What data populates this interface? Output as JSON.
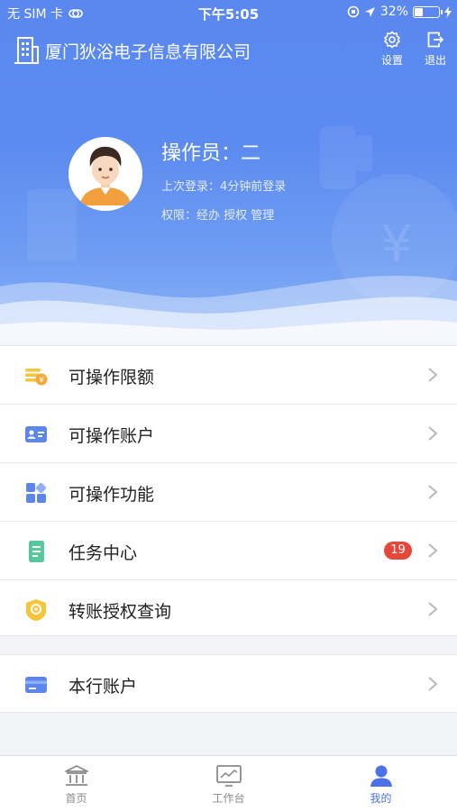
{
  "status": {
    "carrier": "无 SIM 卡",
    "time": "下午5:05",
    "battery": "32%"
  },
  "header": {
    "company": "厦门狄浴电子信息有限公司",
    "settings_label": "设置",
    "logout_label": "退出"
  },
  "profile": {
    "operator": "操作员：二",
    "last_login": "上次登录：4分钟前登录",
    "permissions": "权限：经办 授权 管理"
  },
  "menu_group1": [
    {
      "label": "可操作限额",
      "icon": "coins-icon"
    },
    {
      "label": "可操作账户",
      "icon": "account-card-icon"
    },
    {
      "label": "可操作功能",
      "icon": "grid-apps-icon"
    },
    {
      "label": "任务中心",
      "icon": "task-list-icon",
      "badge": "19"
    },
    {
      "label": "转账授权查询",
      "icon": "authorization-seal-icon"
    }
  ],
  "menu_group2": [
    {
      "label": "本行账户",
      "icon": "bank-card-icon"
    }
  ],
  "tabbar": [
    {
      "label": "首页",
      "icon": "bank-building-icon"
    },
    {
      "label": "工作台",
      "icon": "workbench-chart-icon"
    },
    {
      "label": "我的",
      "icon": "user-profile-icon",
      "active": true
    }
  ],
  "colors": {
    "brand": "#5b8af0",
    "badge": "#e5483b",
    "tab_active": "#4b72e6"
  }
}
